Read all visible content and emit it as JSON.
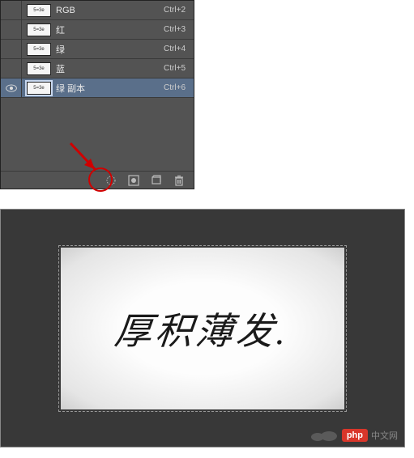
{
  "channels": {
    "thumb_text": "5=3e",
    "rows": [
      {
        "name": "RGB",
        "shortcut": "Ctrl+2",
        "visible": false,
        "selected": false
      },
      {
        "name": "红",
        "shortcut": "Ctrl+3",
        "visible": false,
        "selected": false
      },
      {
        "name": "绿",
        "shortcut": "Ctrl+4",
        "visible": false,
        "selected": false
      },
      {
        "name": "蓝",
        "shortcut": "Ctrl+5",
        "visible": false,
        "selected": false
      },
      {
        "name": "绿 副本",
        "shortcut": "Ctrl+6",
        "visible": true,
        "selected": true
      }
    ],
    "footer_icons": {
      "load_selection": "load-selection-icon",
      "save_mask": "save-mask-icon",
      "new_channel": "new-channel-icon",
      "delete_channel": "delete-channel-icon"
    }
  },
  "annotation": {
    "arrow_color": "#d00000",
    "circle_color": "#d00000"
  },
  "canvas": {
    "calligraphy_text": "厚积薄发.",
    "watermark_logo": "php",
    "watermark_text": "中文网"
  }
}
